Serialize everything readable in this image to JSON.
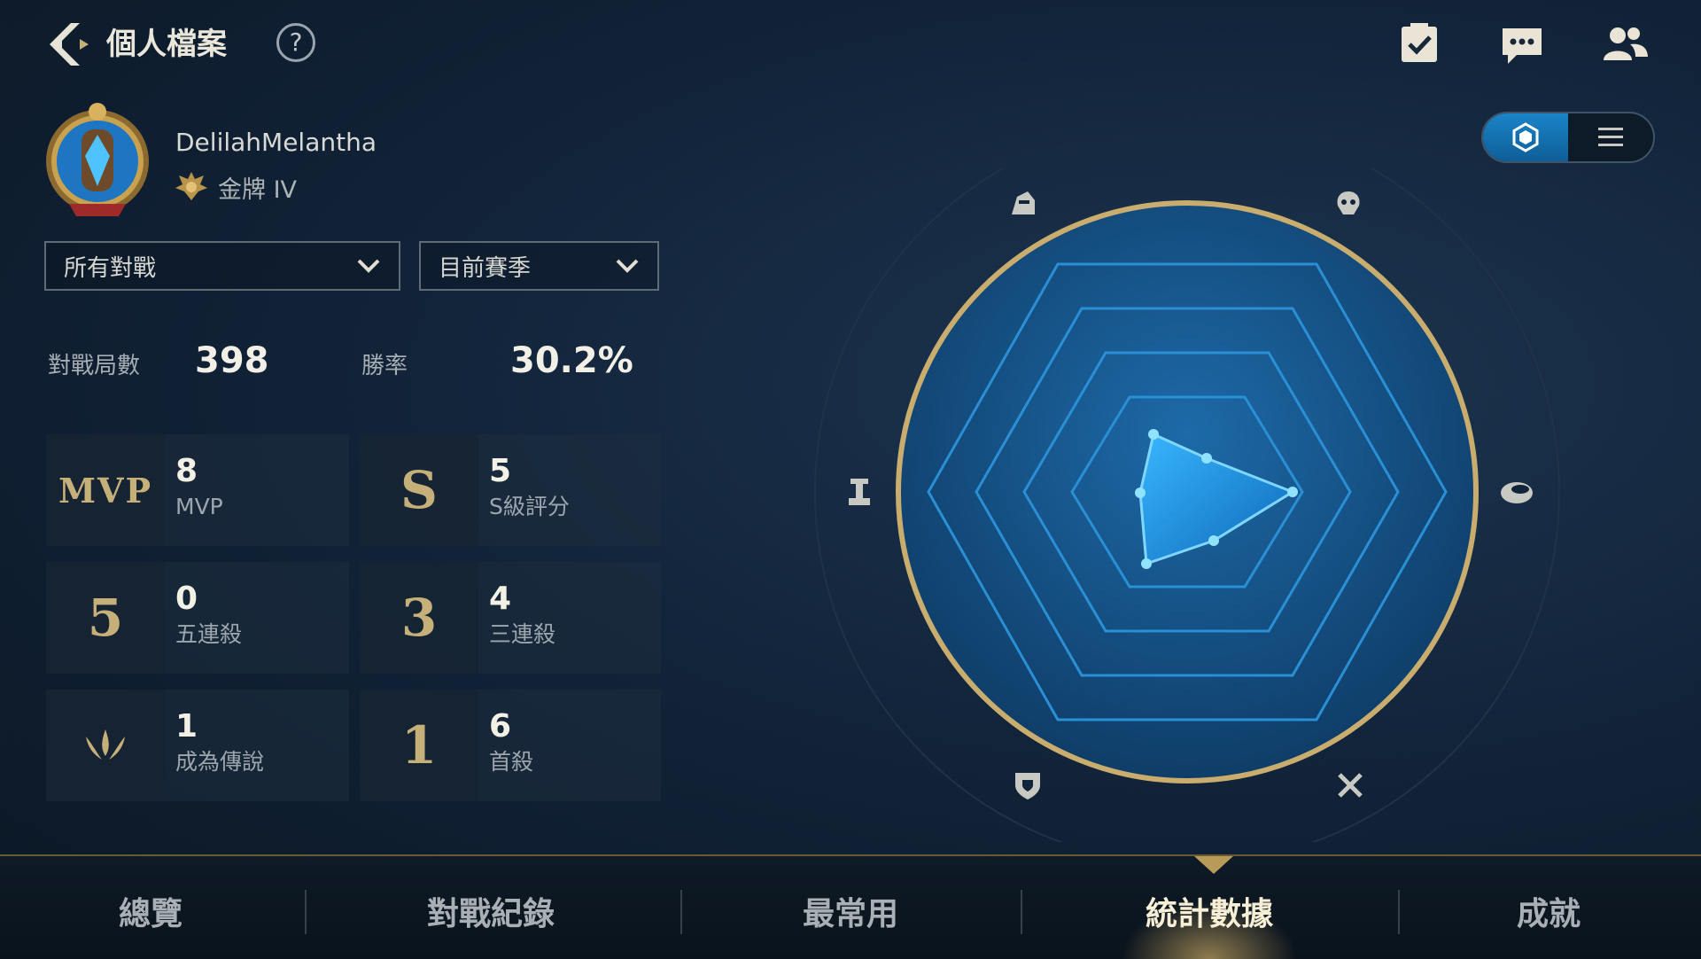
{
  "header": {
    "title": "個人檔案",
    "help_label": "?",
    "icons": [
      "back-arrow-icon",
      "help-icon",
      "checklist-icon",
      "chat-icon",
      "friends-icon"
    ]
  },
  "profile": {
    "username": "DelilahMelantha",
    "rank": "金牌 IV"
  },
  "filters": {
    "mode": "所有對戰",
    "season": "目前賽季"
  },
  "summary": {
    "matches_label": "對戰局數",
    "matches_value": "398",
    "winrate_label": "勝率",
    "winrate_value": "30.2%"
  },
  "achievements": [
    {
      "glyph": "MVP",
      "value": "8",
      "label": "MVP"
    },
    {
      "glyph": "S",
      "value": "5",
      "label": "S級評分"
    },
    {
      "glyph": "5",
      "value": "0",
      "label": "五連殺"
    },
    {
      "glyph": "3",
      "value": "4",
      "label": "三連殺"
    },
    {
      "glyph": "legend",
      "value": "1",
      "label": "成為傳說"
    },
    {
      "glyph": "1",
      "value": "6",
      "label": "首殺"
    }
  ],
  "radar": {
    "axes_icons": [
      "warrior-icon",
      "assassin-icon",
      "mage-icon",
      "marksman-icon",
      "tank-icon",
      "support-icon"
    ],
    "view_toggle": {
      "active": "hexagon-view-icon",
      "inactive": "list-view-icon"
    },
    "colors": {
      "accent": "#1b9be0",
      "gold": "#c8ad6e"
    }
  },
  "nav": {
    "tabs": [
      "總覽",
      "對戰紀錄",
      "最常用",
      "統計數據",
      "成就"
    ],
    "active_index": 3
  }
}
